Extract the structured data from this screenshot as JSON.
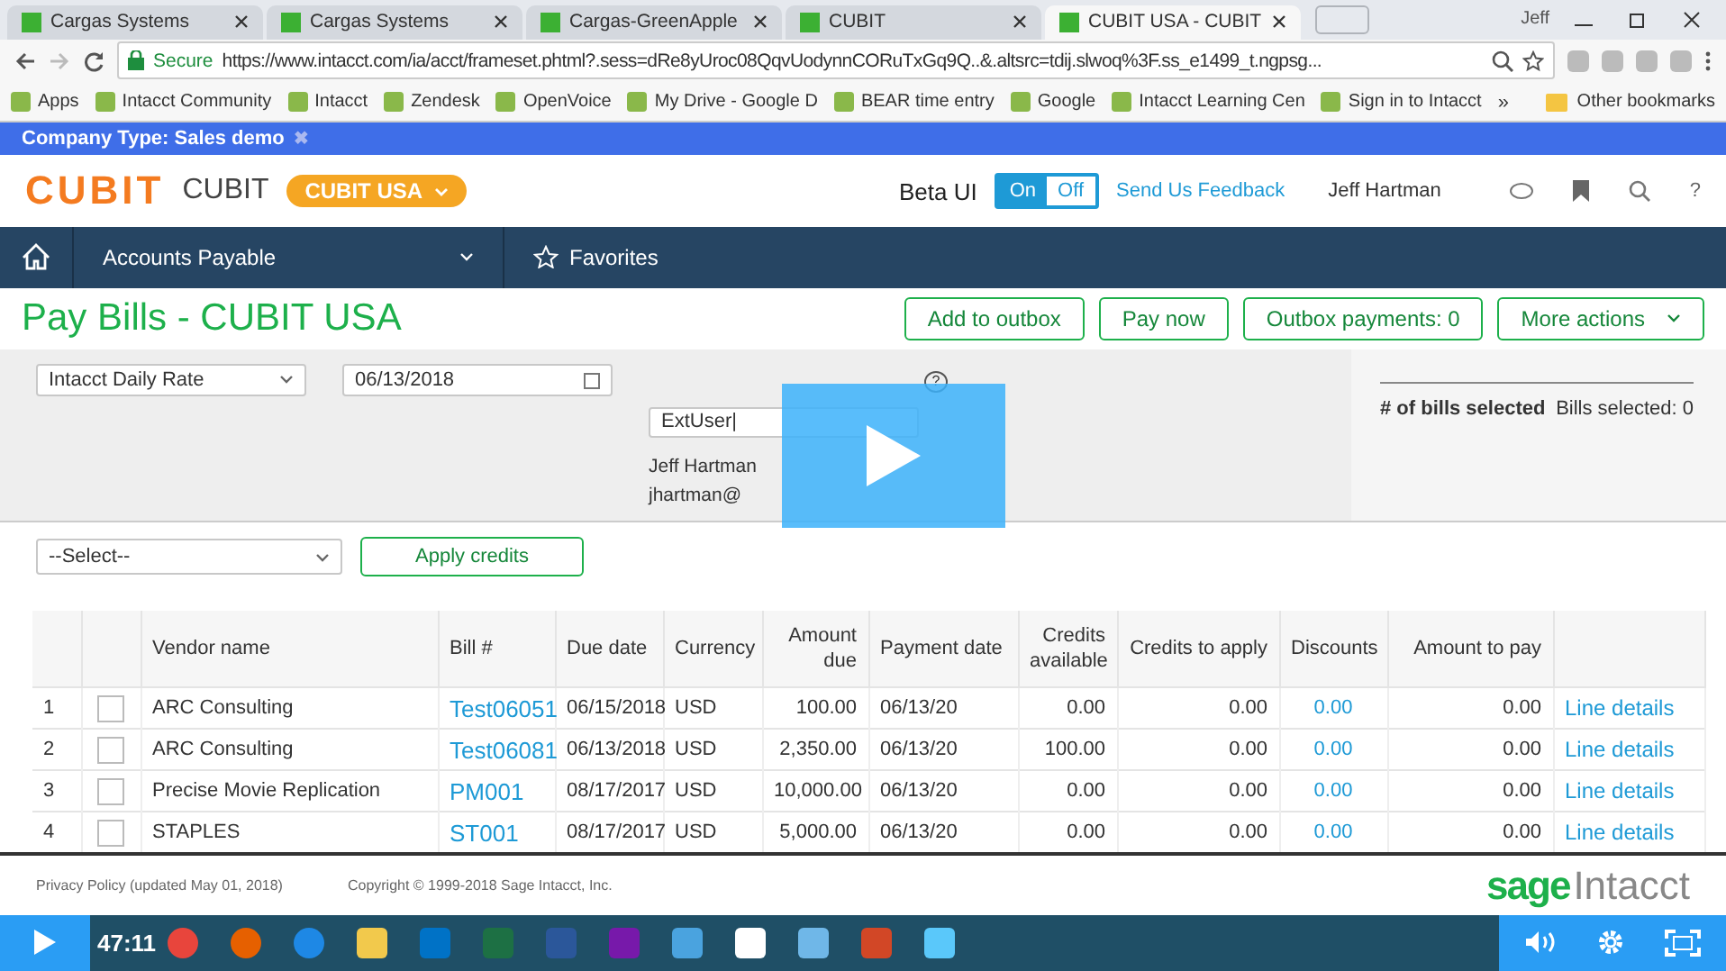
{
  "browser": {
    "tabs": [
      {
        "label": "Cargas Systems",
        "selected": false
      },
      {
        "label": "Cargas Systems",
        "selected": false
      },
      {
        "label": "Cargas-GreenApple",
        "selected": false
      },
      {
        "label": "CUBIT",
        "selected": false
      },
      {
        "label": "CUBIT USA - CUBIT",
        "selected": true
      }
    ],
    "profile": "Jeff",
    "address": {
      "secure": "Secure",
      "url": "https://www.intacct.com/ia/acct/frameset.phtml?.sess=dRe8yUroc08QqvUodynnCORuTxGq9Q..&.altsrc=tdij.slwoq%3F.ss_e1499_t.ngpsg..."
    },
    "bookmarks": [
      "Apps",
      "Intacct Community",
      "Intacct",
      "Zendesk",
      "OpenVoice",
      "My Drive - Google D",
      "BEAR time entry",
      "Google",
      "Intacct Learning Cen",
      "Sign in to Intacct"
    ],
    "overflow": "»",
    "other_bookmarks": "Other bookmarks"
  },
  "banner": {
    "text": "Company Type: Sales demo",
    "close": "✖"
  },
  "header": {
    "logo": "CUBIT",
    "company": "CUBIT",
    "entity": "CUBIT USA",
    "beta_label": "Beta UI",
    "toggle": [
      {
        "label": "On",
        "selected": true
      },
      {
        "label": "Off",
        "selected": false
      }
    ],
    "feedback": "Send Us Feedback",
    "user": "Jeff Hartman",
    "help": "?"
  },
  "nav": {
    "module": "Accounts Payable",
    "favorites": "Favorites"
  },
  "page": {
    "title": "Pay Bills - CUBIT USA",
    "actions": [
      "Add to outbox",
      "Pay now",
      "Outbox payments: 0",
      "More actions"
    ]
  },
  "filters": {
    "rate": "Intacct Daily Rate",
    "date": "06/13/2018",
    "help": "?",
    "user_select": "ExtUser|",
    "user_name": "Jeff Hartman",
    "user_email": "jhartman@",
    "summary_label": "# of bills selected",
    "summary_value": "Bills selected: 0"
  },
  "credits": {
    "select": "--Select--",
    "button": "Apply credits"
  },
  "table": {
    "columns": [
      "Vendor name",
      "Bill #",
      "Due date",
      "Currency",
      "Amount due",
      "Payment date",
      "Credits available",
      "Credits to apply",
      "Discounts",
      "Amount to pay"
    ],
    "rows": [
      {
        "index": "1",
        "checked": false,
        "cells": [
          "ARC Consulting",
          "Test06051",
          "06/15/2018",
          "USD",
          "100.00",
          "06/13/20",
          "0.00",
          "0.00",
          "0.00",
          "0.00"
        ],
        "details": "Line details"
      },
      {
        "index": "2",
        "checked": false,
        "cells": [
          "ARC Consulting",
          "Test06081",
          "06/13/2018",
          "USD",
          "2,350.00",
          "06/13/20",
          "100.00",
          "0.00",
          "0.00",
          "0.00"
        ],
        "details": "Line details"
      },
      {
        "index": "3",
        "checked": false,
        "cells": [
          "Precise Movie Replication",
          "PM001",
          "08/17/2017",
          "USD",
          "10,000.00",
          "06/13/20",
          "0.00",
          "0.00",
          "0.00",
          "0.00"
        ],
        "details": "Line details"
      },
      {
        "index": "4",
        "checked": false,
        "cells": [
          "STAPLES",
          "ST001",
          "08/17/2017",
          "USD",
          "5,000.00",
          "06/13/20",
          "0.00",
          "0.00",
          "0.00",
          "0.00"
        ],
        "details": "Line details"
      }
    ]
  },
  "footer": {
    "privacy": "Privacy Policy (updated May 01, 2018)",
    "copyright": "Copyright © 1999-2018 Sage Intacct, Inc.",
    "brand_mark": "sage",
    "brand_name": "Intacct"
  },
  "player": {
    "time": "47:11"
  }
}
